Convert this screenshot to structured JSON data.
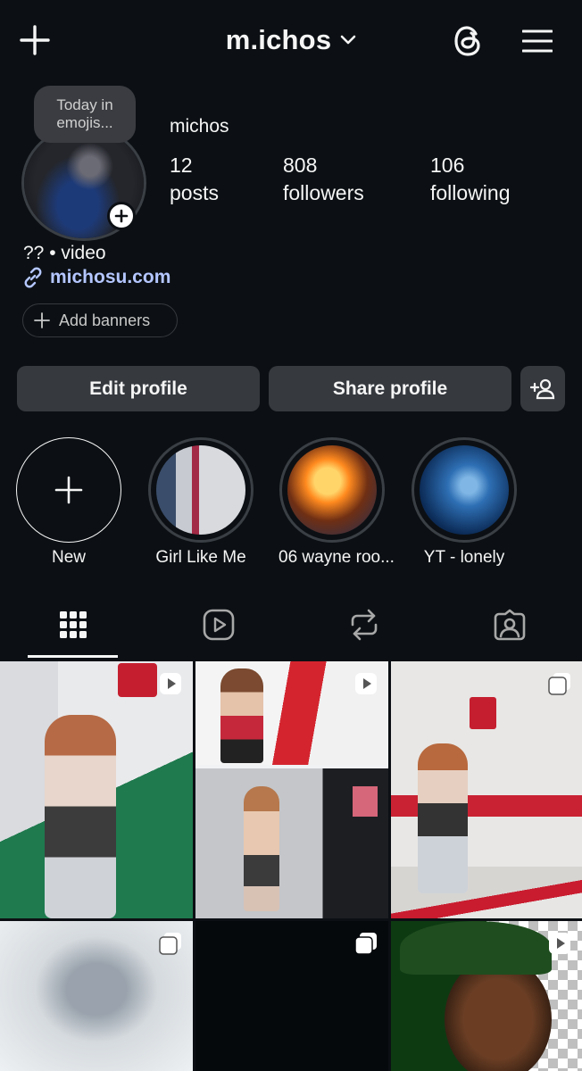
{
  "header": {
    "username": "m.ichos",
    "icons": {
      "create": "plus-icon",
      "switch": "chevron-down-icon",
      "threads": "threads-icon",
      "menu": "hamburger-menu-icon"
    }
  },
  "profile": {
    "note_line1": "Today in",
    "note_line2": "emojis...",
    "display_name": "michos",
    "stats": {
      "posts_count": "12",
      "posts_label": "posts",
      "followers_count": "808",
      "followers_label": "followers",
      "following_count": "106",
      "following_label": "following"
    },
    "bio": "?? • video",
    "link": "michosu.com",
    "add_banners": "Add banners"
  },
  "actions": {
    "edit_profile": "Edit profile",
    "share_profile": "Share profile",
    "discover_people_icon": "add-person-icon"
  },
  "highlights": [
    {
      "label": "New"
    },
    {
      "label": "Girl Like Me"
    },
    {
      "label": "06 wayne roo..."
    },
    {
      "label": "YT - lonely"
    }
  ],
  "tabs": [
    {
      "icon": "grid-icon",
      "active": true
    },
    {
      "icon": "reels-icon",
      "active": false
    },
    {
      "icon": "reposts-icon",
      "active": false
    },
    {
      "icon": "tagged-icon",
      "active": false
    }
  ],
  "grid": [
    {
      "badge": "reel-icon"
    },
    {
      "badge": "reel-icon"
    },
    {
      "badge": "carousel-icon"
    },
    {
      "badge": "carousel-icon"
    },
    {
      "badge": "carousel-icon"
    },
    {
      "badge": "reel-icon"
    }
  ],
  "colors": {
    "background": "#0c1014",
    "button": "#363a3f",
    "link": "#b4c6ff",
    "text": "#f5f5f5"
  }
}
